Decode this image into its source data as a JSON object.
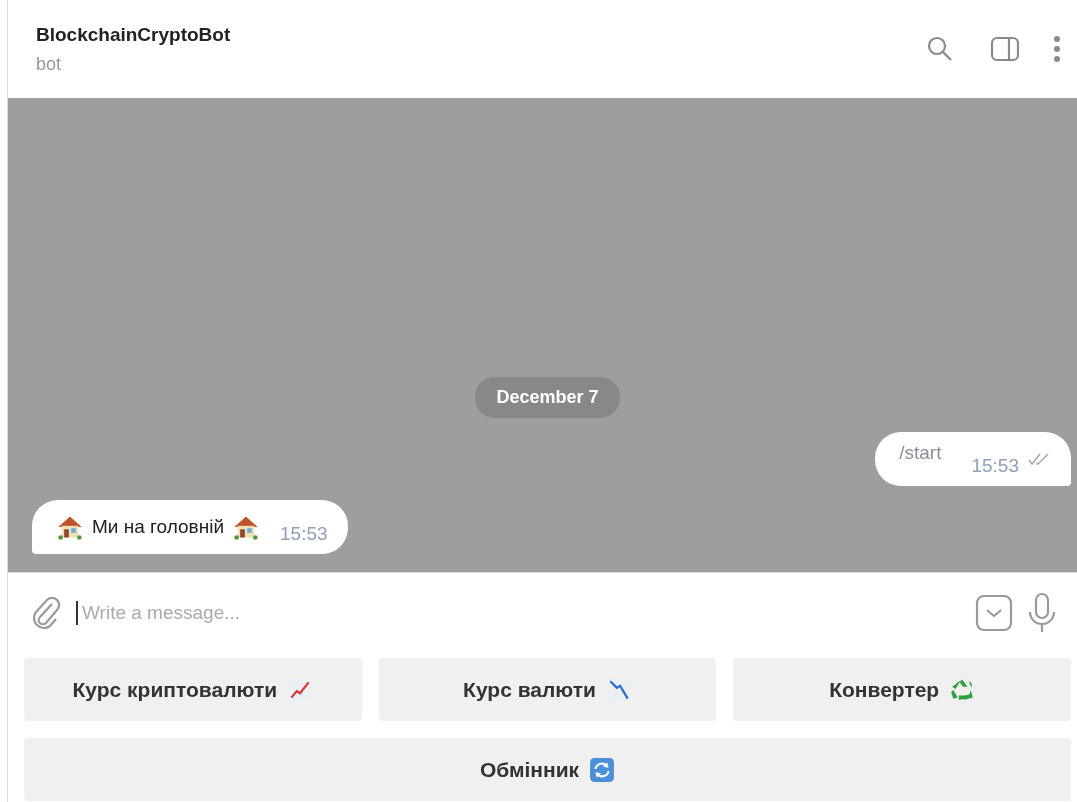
{
  "header": {
    "title": "BlockchainCryptoBot",
    "subtitle": "bot"
  },
  "chat": {
    "date": "December 7",
    "messages": [
      {
        "kind": "sent",
        "text": "/start",
        "time": "15:53",
        "read": true
      },
      {
        "kind": "received",
        "text": "Ми на головній",
        "time": "15:53"
      }
    ]
  },
  "composer": {
    "placeholder": "Write a message..."
  },
  "keyboard": [
    [
      {
        "label": "Курс криптовалюти",
        "kind": "chart-up"
      },
      {
        "label": "Курс валюти",
        "kind": "chart-down"
      },
      {
        "label": "Конвертер",
        "kind": "recycle"
      }
    ],
    [
      {
        "label": "Обмінник",
        "kind": "refresh"
      }
    ]
  ]
}
